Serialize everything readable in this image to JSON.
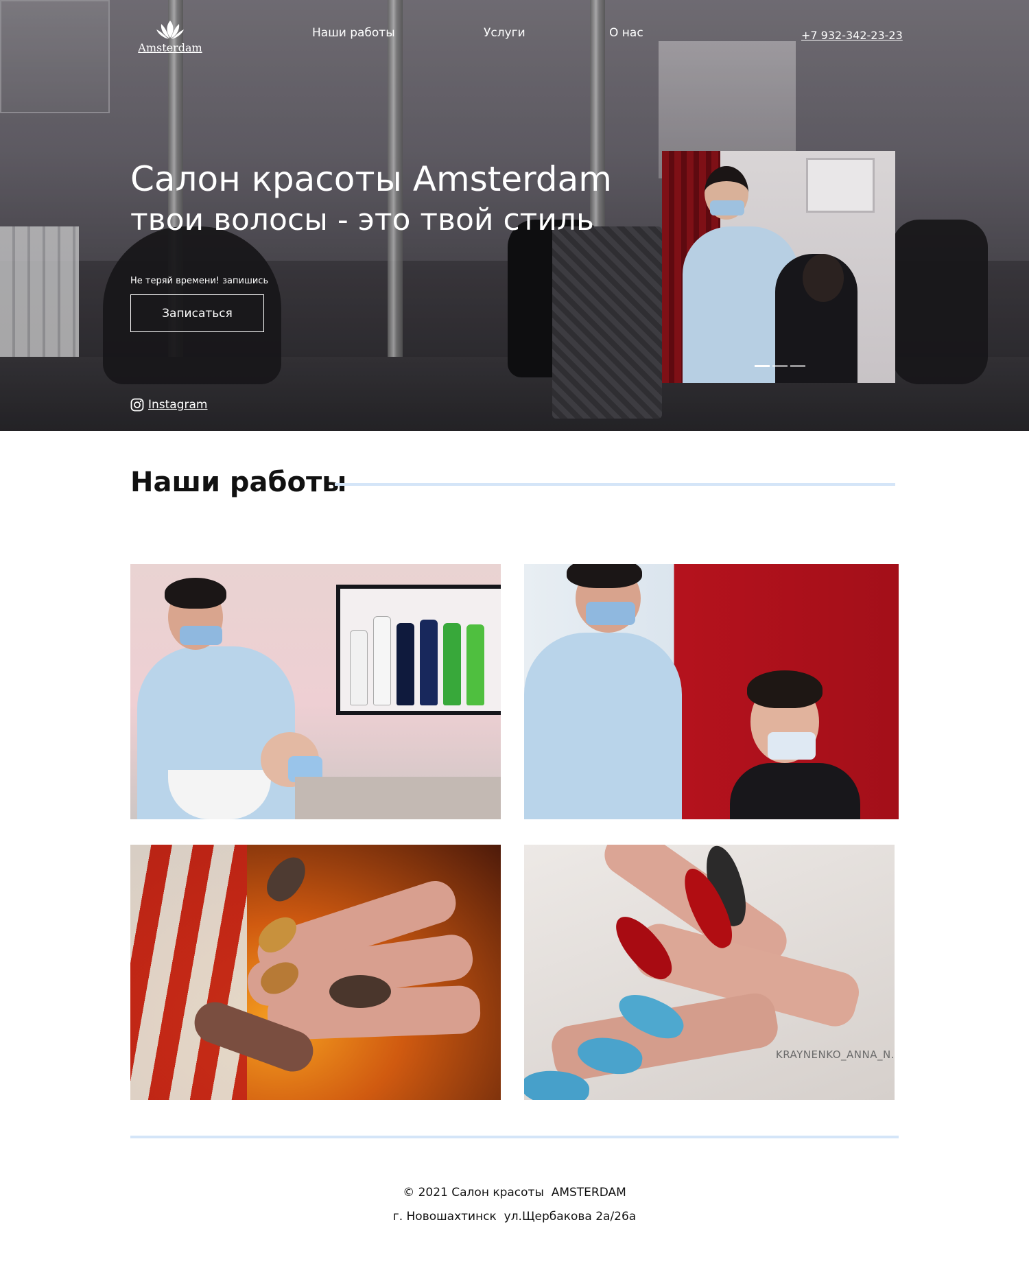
{
  "brand": {
    "logo_text": "Amsterdam"
  },
  "nav": {
    "items": [
      "Наши работы",
      "Услуги",
      "О нас"
    ],
    "phone": "+7 932-342-23-23"
  },
  "hero": {
    "title": "Салон красоты Amsterdam",
    "subtitle": "твои волосы - это твой стиль",
    "cta_note": "Не теряй времени! запишись",
    "cta_button": "Записаться",
    "social_label": "Instagram",
    "slider": {
      "total_slides": 3,
      "active_slide": 1
    }
  },
  "works": {
    "title": "Наши работы",
    "watermark": "KRAYNENKO_ANNA_N."
  },
  "footer": {
    "copyright": "© 2021 Салон красоты  AMSTERDAM",
    "address": "г. Новошахтинск  ул.Щербакова 2а/26а"
  },
  "colors": {
    "accent_line": "#d4e5f8",
    "hero_text": "#ffffff"
  },
  "icons": [
    "lotus-logo-icon",
    "instagram-icon"
  ]
}
